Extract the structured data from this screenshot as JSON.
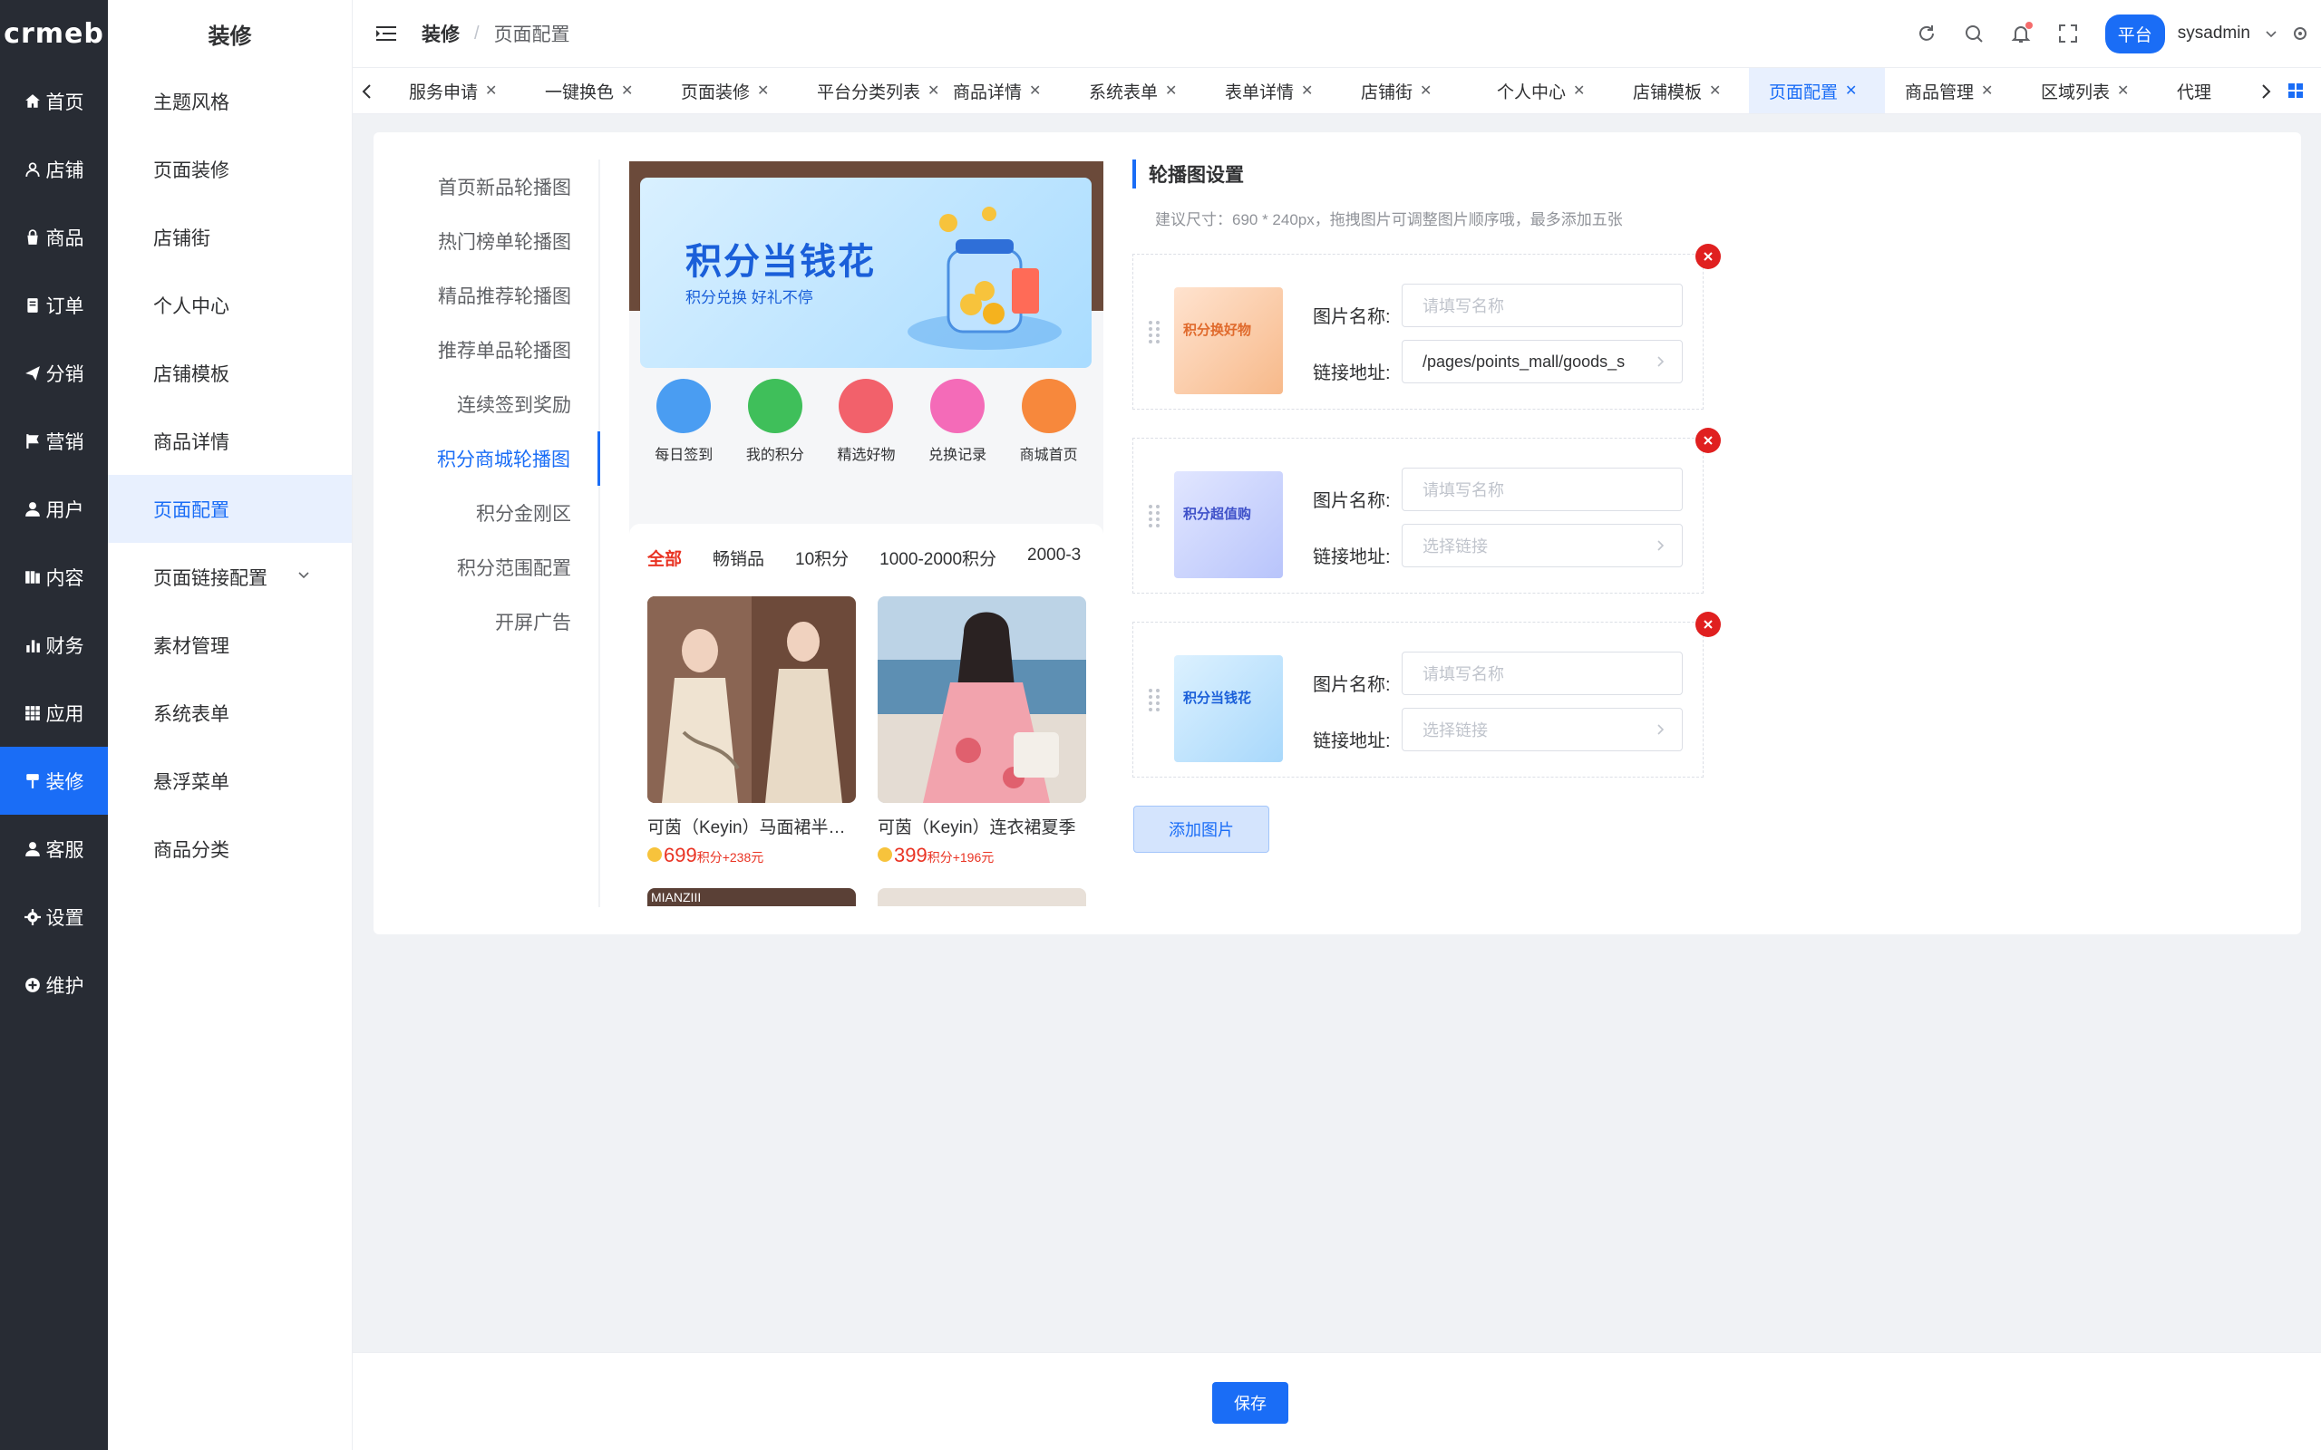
{
  "logo": {
    "text": "crmeb"
  },
  "sidebar": {
    "items": [
      {
        "label": "首页",
        "icon": "home-icon"
      },
      {
        "label": "店铺",
        "icon": "user-icon"
      },
      {
        "label": "商品",
        "icon": "bag-icon"
      },
      {
        "label": "订单",
        "icon": "order-icon"
      },
      {
        "label": "分销",
        "icon": "send-icon"
      },
      {
        "label": "营销",
        "icon": "flag-icon"
      },
      {
        "label": "用户",
        "icon": "person-icon"
      },
      {
        "label": "内容",
        "icon": "content-icon"
      },
      {
        "label": "财务",
        "icon": "chart-icon"
      },
      {
        "label": "应用",
        "icon": "apps-icon"
      },
      {
        "label": "装修",
        "icon": "brush-icon",
        "active": true
      },
      {
        "label": "客服",
        "icon": "service-icon"
      },
      {
        "label": "设置",
        "icon": "gear-icon"
      },
      {
        "label": "维护",
        "icon": "plus-circle-icon"
      }
    ]
  },
  "submenu": {
    "title": "装修",
    "items": [
      {
        "label": "主题风格"
      },
      {
        "label": "页面装修"
      },
      {
        "label": "店铺街"
      },
      {
        "label": "个人中心"
      },
      {
        "label": "店铺模板"
      },
      {
        "label": "商品详情"
      },
      {
        "label": "页面配置",
        "active": true
      },
      {
        "label": "页面链接配置",
        "has_children": true
      },
      {
        "label": "素材管理"
      },
      {
        "label": "系统表单"
      },
      {
        "label": "悬浮菜单"
      },
      {
        "label": "商品分类"
      }
    ]
  },
  "header": {
    "breadcrumb": [
      "装修",
      "页面配置"
    ],
    "separator": "/",
    "platform_label": "平台",
    "username": "sysadmin"
  },
  "tabs": [
    "服务申请",
    "一键换色",
    "页面装修",
    "平台分类列表",
    "商品详情",
    "系统表单",
    "表单详情",
    "店铺街",
    "个人中心",
    "店铺模板",
    "页面配置",
    "商品管理",
    "区域列表",
    "代理"
  ],
  "active_tab": "页面配置",
  "config_menu": {
    "items": [
      "首页新品轮播图",
      "热门榜单轮播图",
      "精品推荐轮播图",
      "推荐单品轮播图",
      "连续签到奖励",
      "积分商城轮播图",
      "积分金刚区",
      "积分范围配置",
      "开屏广告"
    ],
    "active": "积分商城轮播图"
  },
  "preview": {
    "banner_title": "积分当钱花",
    "banner_sub": "积分兑换  好礼不停",
    "shortcuts": [
      "每日签到",
      "我的积分",
      "精选好物",
      "兑换记录",
      "商城首页"
    ],
    "filters": [
      "全部",
      "畅销品",
      "10积分",
      "1000-2000积分",
      "2000-3"
    ],
    "products": [
      {
        "name": "可茵（Keyin）马面裙半身裙",
        "points": "699",
        "unit": "积分",
        "extra": "+238元"
      },
      {
        "name": "可茵（Keyin）连衣裙夏季",
        "points": "399",
        "unit": "积分",
        "extra": "+196元"
      }
    ],
    "next_product_brand": "MIANZIII"
  },
  "settings": {
    "title": "轮播图设置",
    "hint": "建议尺寸：690 * 240px，拖拽图片可调整图片顺序哦，最多添加五张",
    "name_label": "图片名称:",
    "link_label": "链接地址:",
    "name_placeholder": "请填写名称",
    "link_placeholder": "选择链接",
    "slides": [
      {
        "thumb_text": "积分换好物",
        "name_value": "",
        "link_value": "/pages/points_mall/goods_s"
      },
      {
        "thumb_text": "积分超值购",
        "name_value": "",
        "link_value": ""
      },
      {
        "thumb_text": "积分当钱花",
        "name_value": "",
        "link_value": ""
      }
    ],
    "add_button": "添加图片"
  },
  "footer": {
    "save": "保存"
  },
  "colors": {
    "primary": "#1a6df6",
    "sidebar_bg": "#282c34",
    "price_red": "#e93323",
    "delete_red": "#e02020"
  }
}
